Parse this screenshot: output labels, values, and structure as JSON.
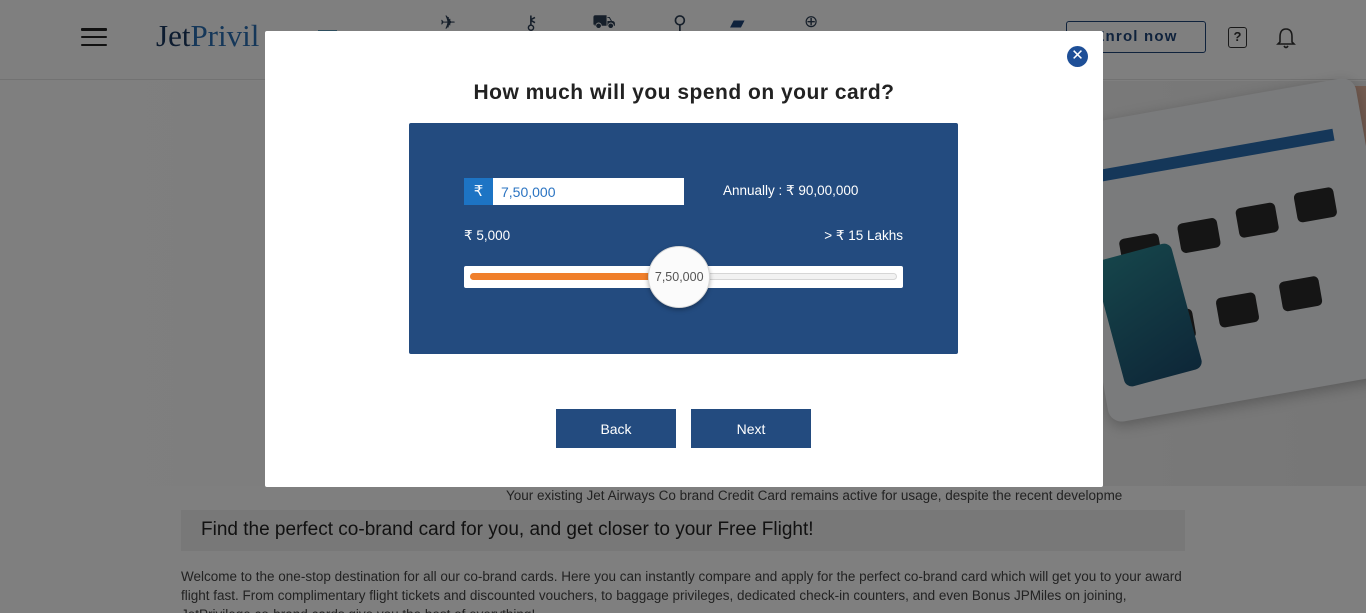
{
  "header": {
    "logo_part1": "Jet",
    "logo_part2": "Privil",
    "enrol_label": "Enrol now",
    "nav_icons": [
      "card-icon",
      "flight-icon",
      "hotel-icon",
      "shopping-cart-icon",
      "dine-icon",
      "co-brand-card-icon",
      "more-icon"
    ]
  },
  "notice": "Your existing Jet Airways Co brand Credit Card remains active for usage, despite the recent developme",
  "find_heading": "Find the perfect co-brand card for you, and get closer to your Free Flight!",
  "welcome_text": "Welcome to the one-stop destination for all our co-brand cards. Here you can instantly compare and apply for the perfect co-brand card which will get you to your award flight fast. From complimentary flight tickets and discounted vouchers, to baggage privileges, dedicated check-in counters, and even Bonus JPMiles on joining, JetPrivilege co-brand cards give you the best of everything!",
  "modal": {
    "title": "How much will you spend on your card?",
    "currency_symbol": "₹",
    "amount_value": "7,50,000",
    "annually_text": "Annually : ₹ 90,00,000",
    "min_label": "₹ 5,000",
    "max_label": "> ₹ 15 Lakhs",
    "slider_value_label": "7,50,000",
    "slider_fraction": 0.49,
    "back_label": "Back",
    "next_label": "Next",
    "close_symbol": "✕"
  },
  "colors": {
    "primary": "#234b7f",
    "accent": "#f07f2b",
    "rupee_tag": "#1d74c4",
    "close": "#1e4f97"
  }
}
